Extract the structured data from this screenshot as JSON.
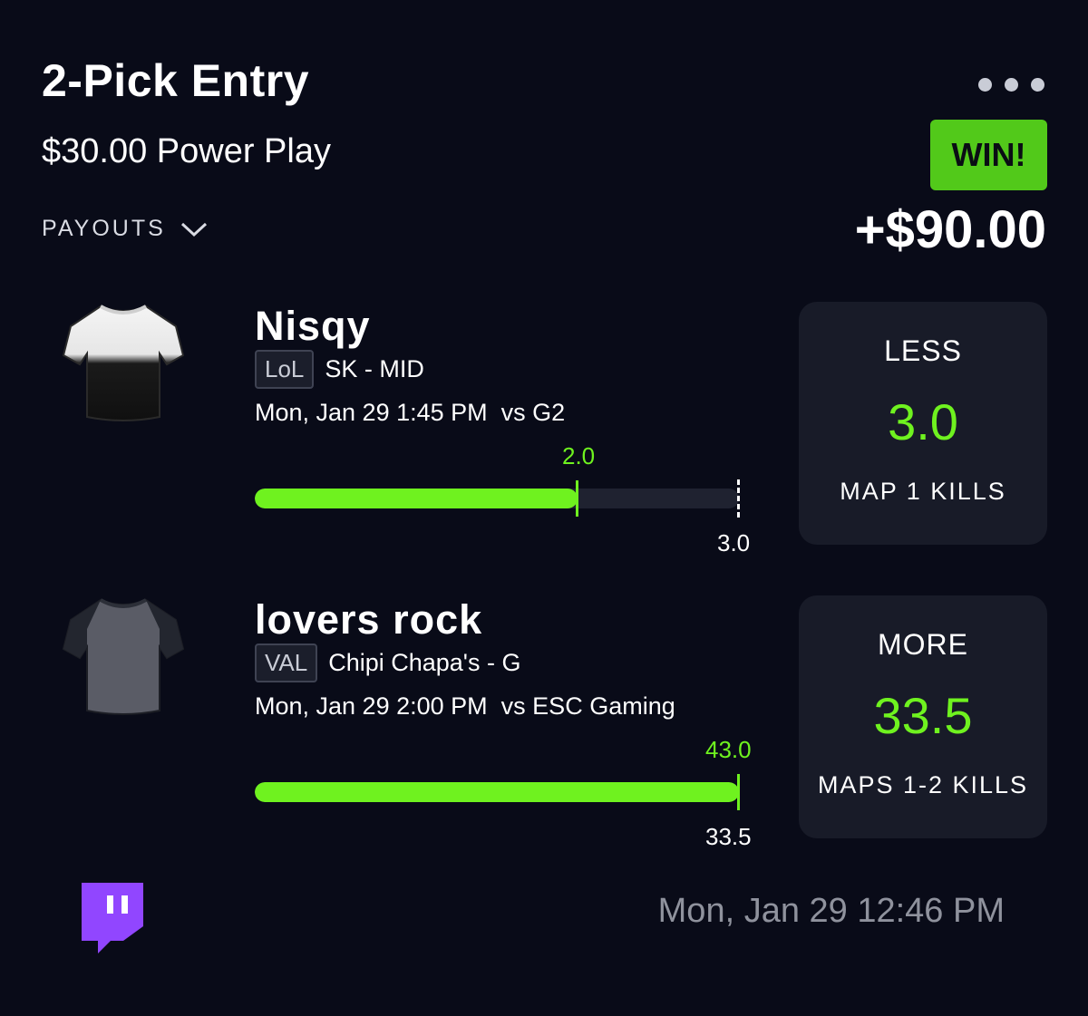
{
  "entry": {
    "title": "2-Pick Entry",
    "subtitle": "$30.00 Power Play",
    "payouts_label": "PAYOUTS",
    "result_badge": "WIN!",
    "payout_amount": "+$90.00"
  },
  "picks": [
    {
      "player": "Nisqy",
      "game_badge": "LoL",
      "team": "SK - MID",
      "schedule": "Mon, Jan 29 1:45 PM",
      "opponent": "vs G2",
      "actual_label": "2.0",
      "line_label": "3.0",
      "progress_fraction": 0.667,
      "direction": "LESS",
      "line_value": "3.0",
      "stat": "MAP 1 KILLS",
      "jersey_colors": [
        "#f2f2f2",
        "#111111"
      ]
    },
    {
      "player": "lovers rock",
      "game_badge": "VAL",
      "team": "Chipi Chapa's - G",
      "schedule": "Mon, Jan 29 2:00 PM",
      "opponent": "vs ESC Gaming",
      "actual_label": "43.0",
      "line_label": "33.5",
      "progress_fraction": 1.0,
      "direction": "MORE",
      "line_value": "33.5",
      "stat": "MAPS 1-2 KILLS",
      "jersey_colors": [
        "#5a5c66",
        "#23262f"
      ]
    }
  ],
  "footer": {
    "timestamp": "Mon, Jan 29 12:46 PM",
    "stream_icon": "twitch-icon"
  },
  "colors": {
    "background": "#090b18",
    "accent_green": "#6ff21f",
    "win_badge": "#52c91a",
    "card": "#181b28",
    "twitch_purple": "#9146ff"
  }
}
